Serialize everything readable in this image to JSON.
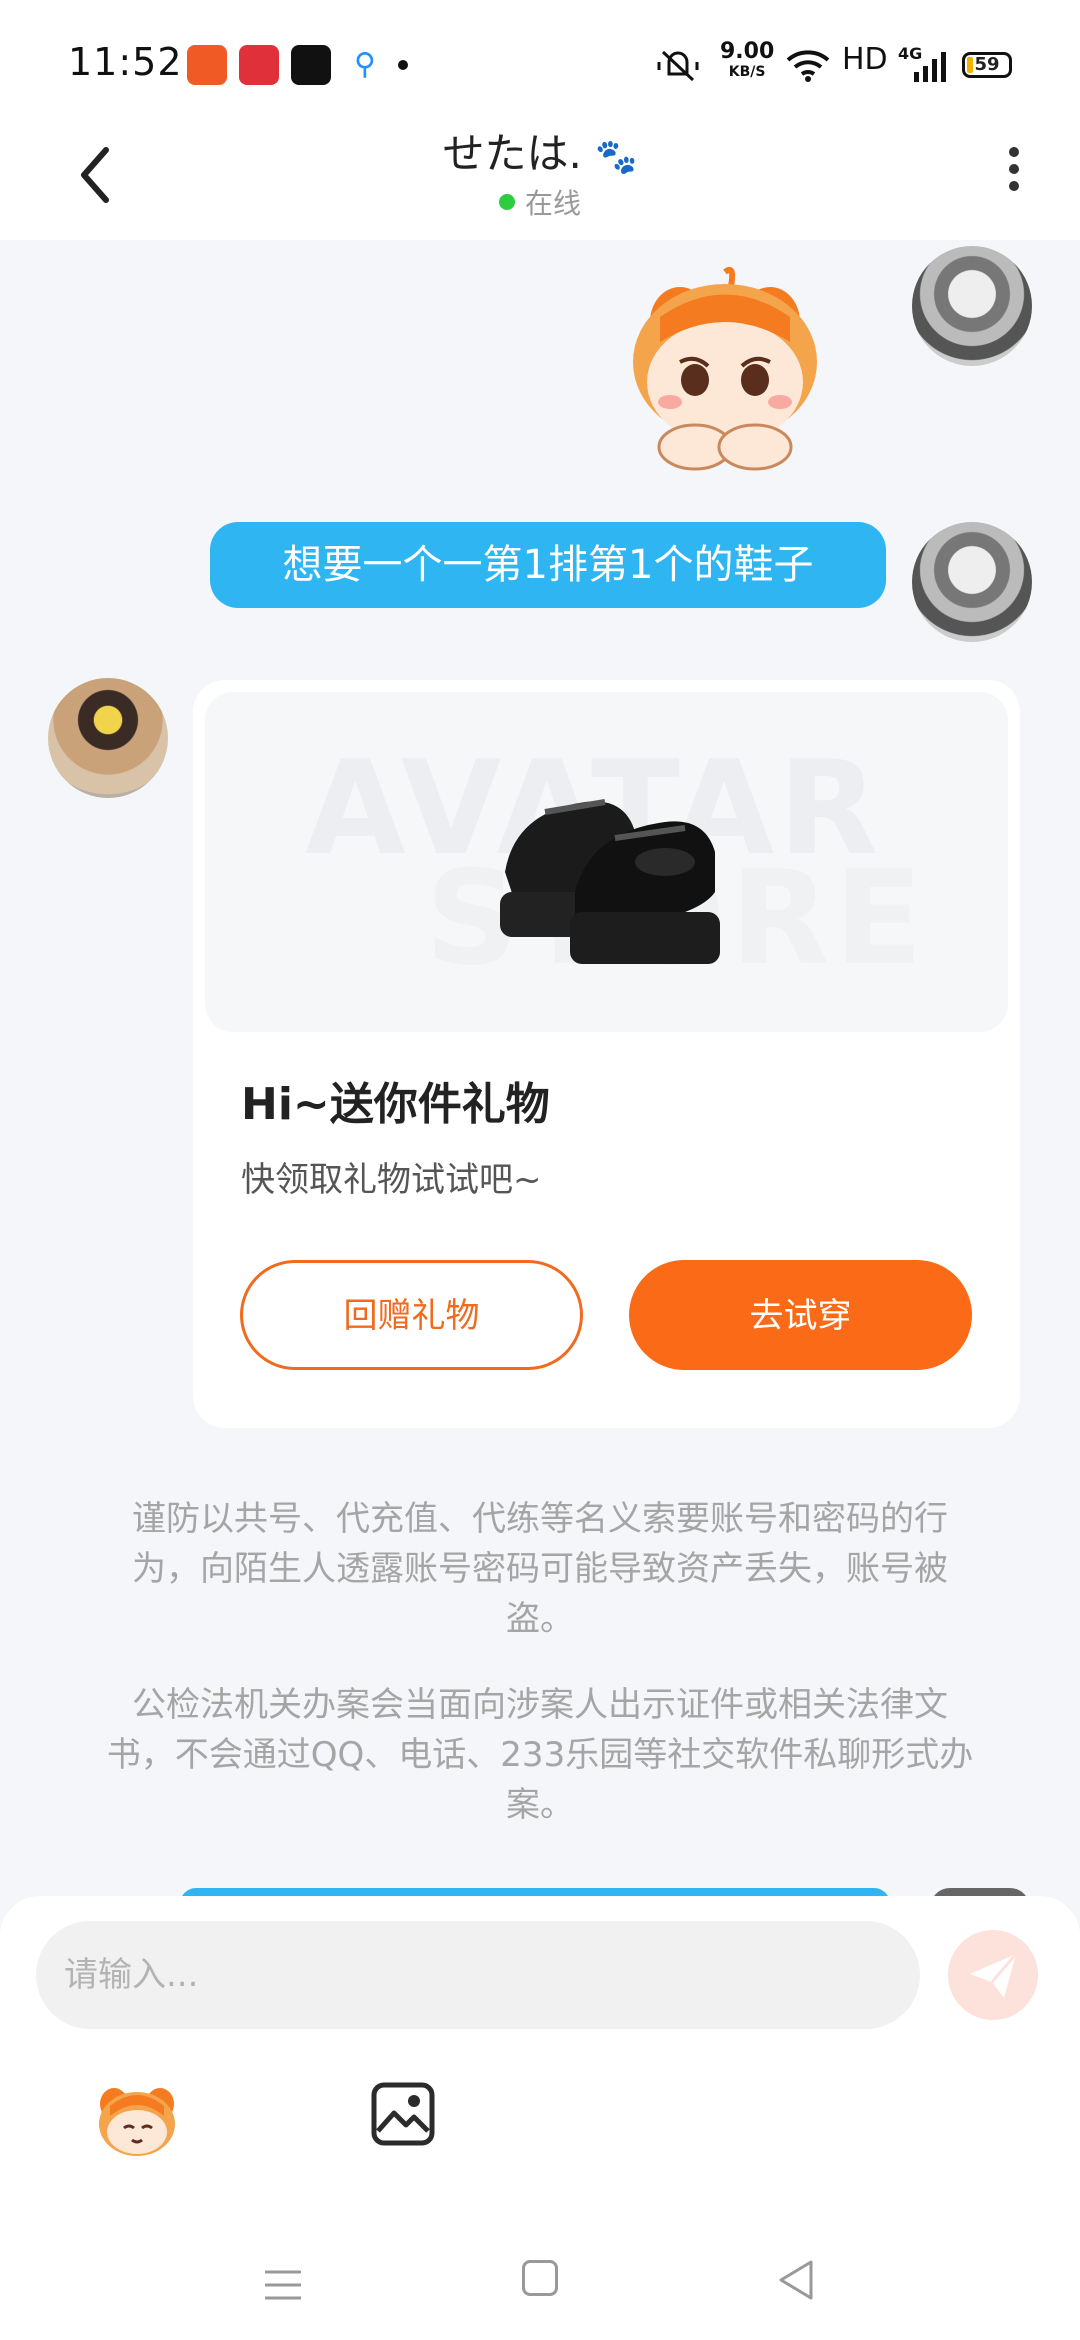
{
  "status_bar": {
    "time": "11:52",
    "net_speed_value": "9.00",
    "net_speed_unit": "KB/S",
    "hd_label": "HD",
    "signal_label": "4G",
    "battery": "59"
  },
  "header": {
    "contact_name": "せたは.",
    "status_text": "在线"
  },
  "chat": {
    "sent_message": "想要一个一第1排第1个的鞋子",
    "gift_card": {
      "watermark_line1": "AVATAR",
      "watermark_line2": "STORE",
      "title": "Hi~送你件礼物",
      "subtitle": "快领取礼物试试吧~",
      "return_gift_label": "回赠礼物",
      "try_on_label": "去试穿"
    },
    "notices": [
      "谨防以共号、代充值、代练等名义索要账号和密码的行为，向陌生人透露账号密码可能导致资产丢失，账号被盗。",
      "公检法机关办案会当面向涉案人出示证件或相关法律文书，不会通过QQ、电话、233乐园等社交软件私聊形式办案。"
    ]
  },
  "input": {
    "placeholder": "请输入..."
  },
  "colors": {
    "accent_blue": "#2fb6f2",
    "accent_orange": "#fb6b17",
    "online_green": "#2ecc40",
    "send_disabled": "#fde2dc"
  },
  "icons": {
    "back": "chevron-left-icon",
    "more": "more-vertical-icon",
    "send": "send-icon",
    "emoji": "emoji-sticker-icon",
    "image": "image-icon",
    "paw": "paw-icon"
  }
}
